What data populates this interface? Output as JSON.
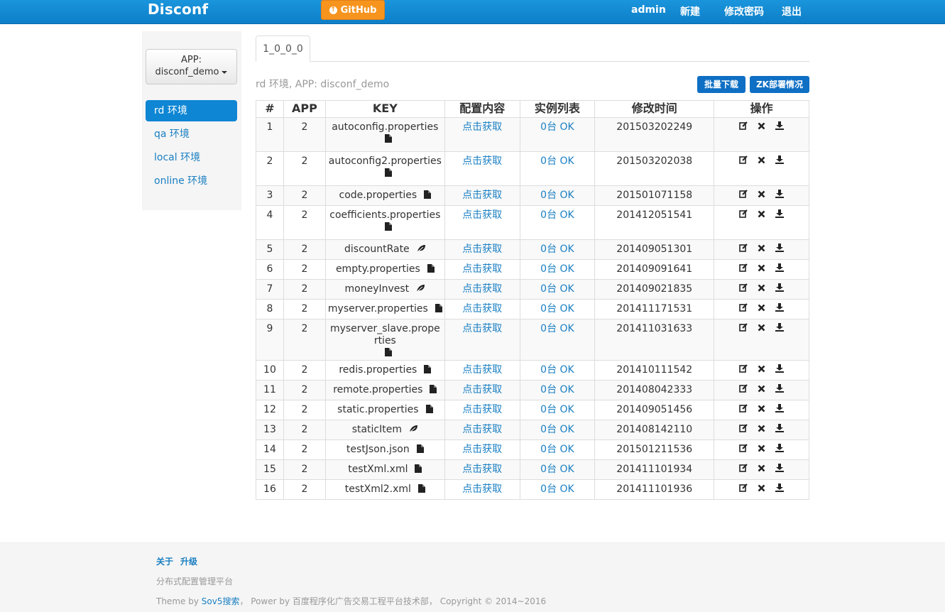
{
  "nav": {
    "brand": "Disconf",
    "github_label": "GitHub",
    "user": "admin",
    "new": "新建",
    "change_password": "修改密码",
    "logout": "退出"
  },
  "sidebar": {
    "app_label": "APP:",
    "app_value": "disconf_demo",
    "envs": [
      {
        "label": "rd 环境",
        "active": true
      },
      {
        "label": "qa 环境",
        "active": false
      },
      {
        "label": "local 环境",
        "active": false
      },
      {
        "label": "online 环境",
        "active": false
      }
    ]
  },
  "main": {
    "version_tab": "1_0_0_0",
    "env_info": "rd 环境, APP: disconf_demo",
    "batch_download": "批量下载",
    "zk_status": "ZK部署情况",
    "table": {
      "headers": [
        "#",
        "APP",
        "KEY",
        "配置内容",
        "实例列表",
        "修改时间",
        "操作"
      ],
      "rows": [
        {
          "n": "1",
          "app": "2",
          "key": "autoconfig.properties",
          "icon": "file-icon",
          "content": "点击获取",
          "instances": "0台 OK",
          "time": "201503202249"
        },
        {
          "n": "2",
          "app": "2",
          "key": "autoconfig2.properties",
          "icon": "file-icon",
          "content": "点击获取",
          "instances": "0台 OK",
          "time": "201503202038"
        },
        {
          "n": "3",
          "app": "2",
          "key": "code.properties",
          "icon": "file-icon",
          "content": "点击获取",
          "instances": "0台 OK",
          "time": "201501071158"
        },
        {
          "n": "4",
          "app": "2",
          "key": "coefficients.properties",
          "icon": "file-icon",
          "content": "点击获取",
          "instances": "0台 OK",
          "time": "201412051541"
        },
        {
          "n": "5",
          "app": "2",
          "key": "discountRate",
          "icon": "leaf-icon",
          "content": "点击获取",
          "instances": "0台 OK",
          "time": "201409051301"
        },
        {
          "n": "6",
          "app": "2",
          "key": "empty.properties",
          "icon": "file-icon",
          "content": "点击获取",
          "instances": "0台 OK",
          "time": "201409091641"
        },
        {
          "n": "7",
          "app": "2",
          "key": "moneyInvest",
          "icon": "leaf-icon",
          "content": "点击获取",
          "instances": "0台 OK",
          "time": "201409021835"
        },
        {
          "n": "8",
          "app": "2",
          "key": "myserver.properties",
          "icon": "file-icon",
          "content": "点击获取",
          "instances": "0台 OK",
          "time": "201411171531"
        },
        {
          "n": "9",
          "app": "2",
          "key": "myserver_slave.properties",
          "icon": "file-icon",
          "content": "点击获取",
          "instances": "0台 OK",
          "time": "201411031633"
        },
        {
          "n": "10",
          "app": "2",
          "key": "redis.properties",
          "icon": "file-icon",
          "content": "点击获取",
          "instances": "0台 OK",
          "time": "201410111542"
        },
        {
          "n": "11",
          "app": "2",
          "key": "remote.properties",
          "icon": "file-icon",
          "content": "点击获取",
          "instances": "0台 OK",
          "time": "201408042333"
        },
        {
          "n": "12",
          "app": "2",
          "key": "static.properties",
          "icon": "file-icon",
          "content": "点击获取",
          "instances": "0台 OK",
          "time": "201409051456"
        },
        {
          "n": "13",
          "app": "2",
          "key": "staticItem",
          "icon": "leaf-icon",
          "content": "点击获取",
          "instances": "0台 OK",
          "time": "201408142110"
        },
        {
          "n": "14",
          "app": "2",
          "key": "testJson.json",
          "icon": "file-icon",
          "content": "点击获取",
          "instances": "0台 OK",
          "time": "201501211536"
        },
        {
          "n": "15",
          "app": "2",
          "key": "testXml.xml",
          "icon": "file-icon",
          "content": "点击获取",
          "instances": "0台 OK",
          "time": "201411101934"
        },
        {
          "n": "16",
          "app": "2",
          "key": "testXml2.xml",
          "icon": "file-icon",
          "content": "点击获取",
          "instances": "0台 OK",
          "time": "201411101936"
        }
      ],
      "row_actions": [
        "edit-icon",
        "delete-icon",
        "download-icon"
      ]
    }
  },
  "footer": {
    "about": "关于",
    "upgrade": "升级",
    "tagline": "分布式配置管理平台",
    "theme_prefix": "Theme by ",
    "theme_link": "Sov5搜索",
    "power": "， Power by 百度程序化广告交易工程平台技术部， Copyright © 2014~2016"
  }
}
